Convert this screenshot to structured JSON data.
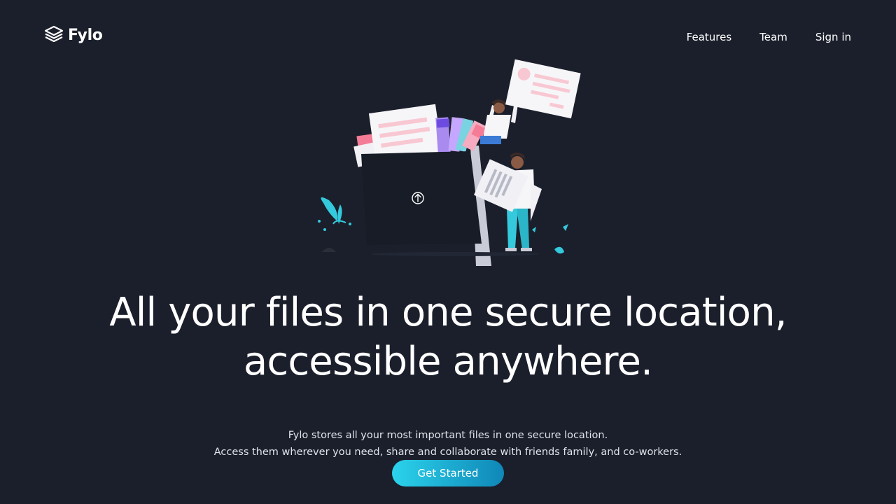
{
  "brand": {
    "name": "Fylo",
    "logo_icon": "layers-icon"
  },
  "nav": {
    "items": [
      {
        "label": "Features"
      },
      {
        "label": "Team"
      },
      {
        "label": "Sign in"
      }
    ]
  },
  "hero": {
    "headline_line1": "All your files in one secure location,",
    "headline_line2": "accessible anywhere.",
    "subtext_line1": "Fylo stores all your most important files in one secure location.",
    "subtext_line2": "Access them wherever you need, share and collaborate with friends family, and co-workers.",
    "cta_label": "Get Started",
    "illustration_icon": "upload-arrow-icon"
  },
  "colors": {
    "background": "#1b1f2b",
    "text": "#ffffff",
    "cta_start": "#2bd3ec",
    "cta_end": "#0f87b7",
    "accent_pink": "#f47c96",
    "accent_teal": "#34c9dc"
  }
}
